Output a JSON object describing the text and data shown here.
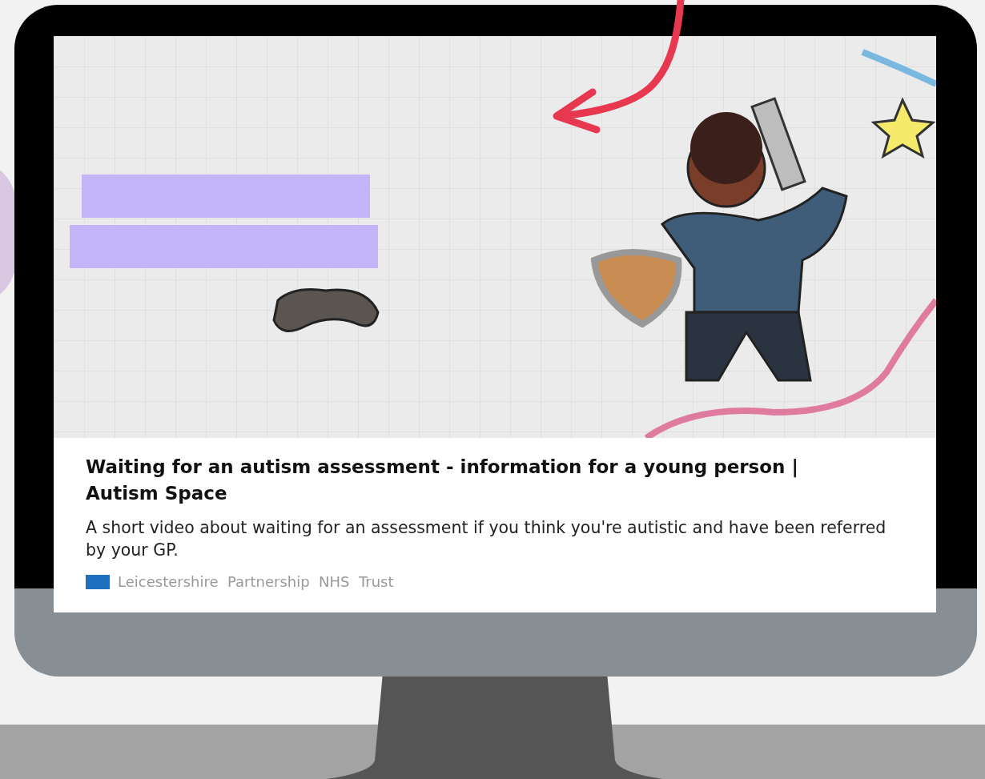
{
  "link_preview": {
    "title": "Waiting for an autism assessment - information for a young person | Autism Space",
    "description": "A short video about waiting for an assessment if you think you're autistic and have been referred by your GP.",
    "source": "Leicestershire  Partnership  NHS  Trust"
  }
}
